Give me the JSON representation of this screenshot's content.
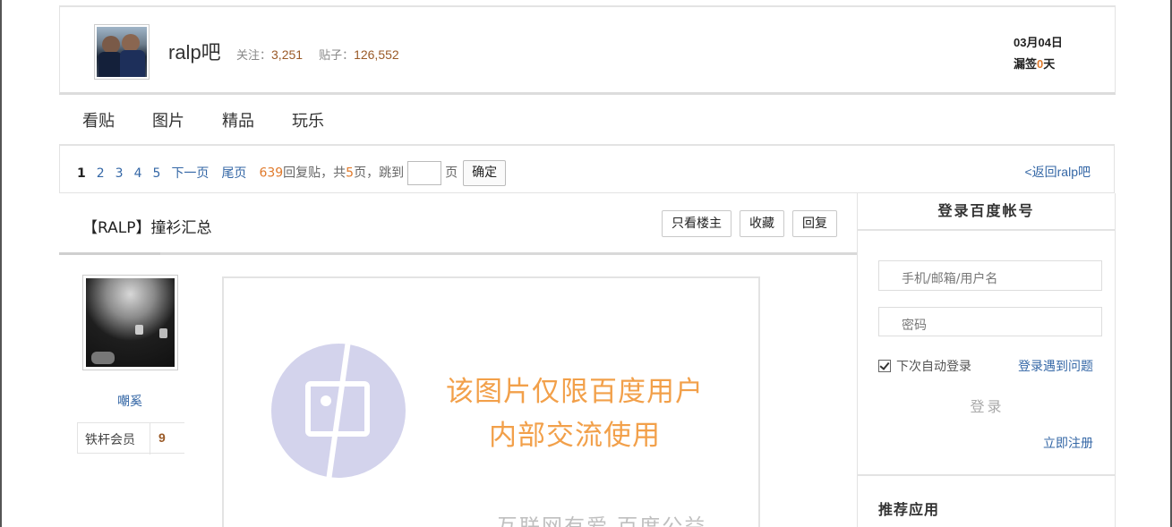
{
  "forum": {
    "name": "ralp吧",
    "follow_label": "关注：",
    "follow_count": "3,251",
    "posts_label": "贴子：",
    "posts_count": "126,552"
  },
  "sign": {
    "date": "03月04日",
    "miss_prefix": "漏签",
    "miss_days": "0",
    "miss_suffix": "天"
  },
  "nav": {
    "tabs": [
      {
        "label": "看贴"
      },
      {
        "label": "图片"
      },
      {
        "label": "精品"
      },
      {
        "label": "玩乐"
      }
    ]
  },
  "pager": {
    "current_page": "1",
    "pages": [
      "2",
      "3",
      "4",
      "5"
    ],
    "next_label": "下一页",
    "last_label": "尾页",
    "reply_count": "639",
    "reply_text": "回复贴，共",
    "total_pages": "5",
    "jump_text": "页，跳到",
    "page_unit": "页",
    "confirm_label": "确定",
    "back_link": "<返回ralp吧"
  },
  "thread": {
    "title": "【RALP】撞衫汇总",
    "btn_only_op": "只看楼主",
    "btn_fav": "收藏",
    "btn_reply": "回复"
  },
  "author": {
    "name": "嘲奚",
    "level_name": "铁杆会员",
    "level_num": "9"
  },
  "post_image": {
    "line1": "该图片仅限百度用户",
    "line2": "内部交流使用",
    "footer": "互联网有爱 百度公益"
  },
  "login": {
    "title": "登录百度帐号",
    "user_placeholder": "手机/邮箱/用户名",
    "pass_placeholder": "密码",
    "remember_label": "下次自动登录",
    "problem_link": "登录遇到问题",
    "login_button": "登录",
    "register_link": "立即注册",
    "recommend_title": "推荐应用"
  },
  "colors": {
    "link": "#3467a6",
    "orange": "#e07a2b",
    "brown": "#9a5a27"
  }
}
